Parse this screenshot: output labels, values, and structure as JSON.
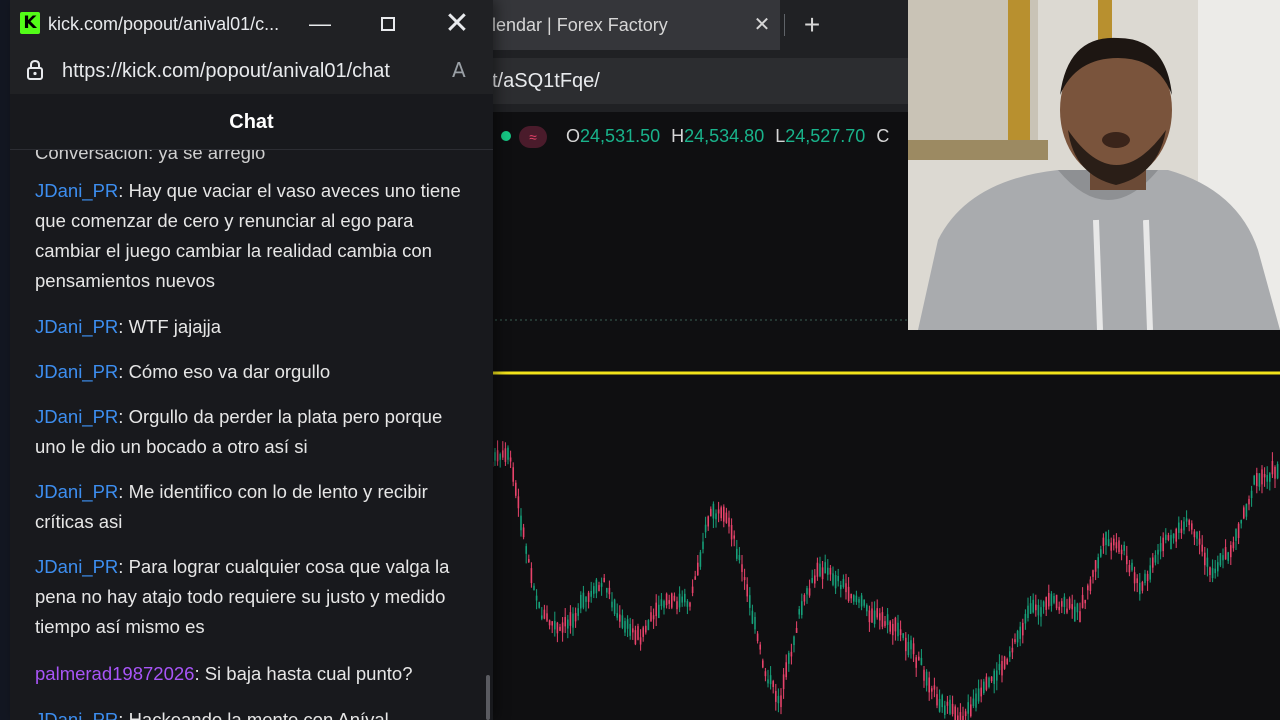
{
  "background_browser": {
    "tab_title": "lendar | Forex Factory",
    "tab_close": "✕",
    "new_tab": "+",
    "address": "t/aSQ1tFqe/"
  },
  "chart": {
    "badge": "≈",
    "open_label": "O",
    "open_value": "24,531.50",
    "high_label": "H",
    "high_value": "24,534.80",
    "low_label": "L",
    "low_value": "24,527.70",
    "close_label": "C",
    "colors": {
      "up": "#16a07a",
      "down": "#e8436b",
      "line": "#f2e31b",
      "bg": "#0f0f11"
    }
  },
  "popout": {
    "title": "kick.com/popout/anival01/c...",
    "minimize": "—",
    "close": "✕",
    "url": "https://kick.com/popout/anival01/chat",
    "read_aloud": "A",
    "chat_header": "Chat"
  },
  "chat": {
    "partial_top": "Conversacion: ya se arreglo",
    "messages": [
      {
        "user": "JDani_PR",
        "text": ": Hay que vaciar el vaso aveces uno tiene que comenzar de cero y renunciar al ego para cambiar el juego cambiar la realidad cambia con pensamientos nuevos"
      },
      {
        "user": "JDani_PR",
        "text": ": WTF jajajja"
      },
      {
        "user": "JDani_PR",
        "text": ": Cómo eso va dar orgullo"
      },
      {
        "user": "JDani_PR",
        "text": ": Orgullo da perder la plata pero porque uno le dio un bocado a otro así si"
      },
      {
        "user": "JDani_PR",
        "text": ": Me identifico con lo de lento y recibir críticas asi"
      },
      {
        "user": "JDani_PR",
        "text": ": Para lograr cualquier cosa que valga la pena no hay atajo todo requiere su justo y medido tiempo así mismo es"
      },
      {
        "user": "palmerad19872026",
        "text": ": Si baja hasta cual punto?"
      },
      {
        "user": "JDani_PR",
        "text": ": Hackeando la mente con Aníval"
      }
    ]
  }
}
